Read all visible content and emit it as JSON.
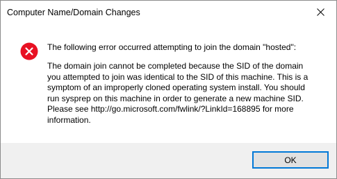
{
  "window": {
    "title": "Computer Name/Domain Changes"
  },
  "dialog": {
    "icon": "error-icon",
    "heading": "The following error occurred attempting to join the domain \"hosted\":",
    "body_lines": [
      "The domain join cannot be completed because the SID of the domain",
      "you attempted to join was identical to the SID of this machine. This is a",
      "symptom of an improperly cloned operating system install.  You should",
      "run sysprep on this machine in order to generate a new machine SID.",
      "Please see http://go.microsoft.com/fwlink/?LinkId=168895 for more",
      "information."
    ]
  },
  "buttons": {
    "ok_label": "OK"
  },
  "colors": {
    "error_red": "#e81123",
    "accent_border": "#0078d7",
    "footer_bg": "#f0f0f0"
  }
}
